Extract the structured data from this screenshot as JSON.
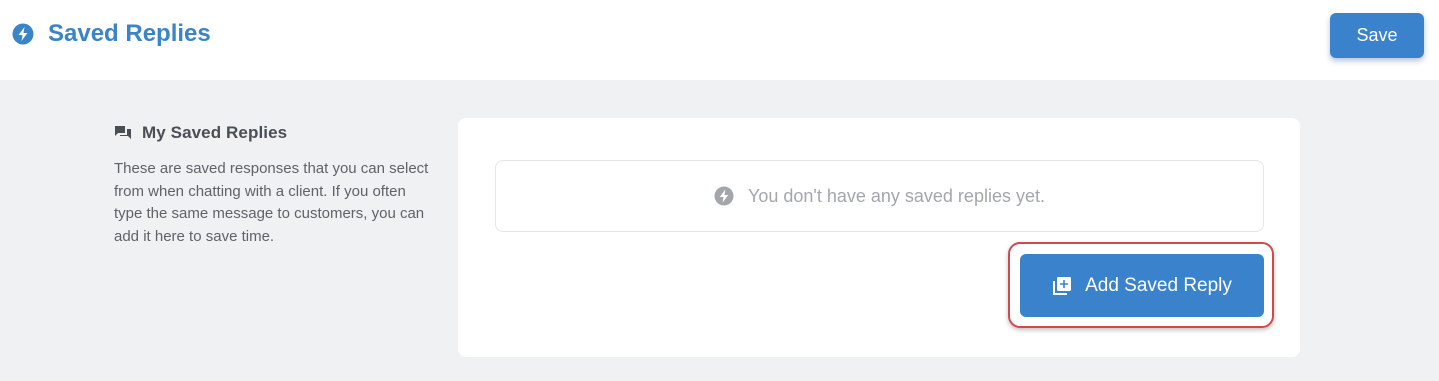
{
  "header": {
    "title": "Saved Replies",
    "title_icon": "lightning-bolt-icon",
    "save_label": "Save"
  },
  "sidebar": {
    "heading": "My Saved Replies",
    "heading_icon": "chat-bubbles-icon",
    "description": "These are saved responses that you can select from when chatting with a client. If you often type the same message to customers, you can add it here to save time."
  },
  "main": {
    "empty_icon": "lightning-bolt-icon",
    "empty_message": "You don't have any saved replies yet.",
    "add_button_label": "Add Saved Reply",
    "add_button_icon": "add-to-library-icon"
  },
  "colors": {
    "accent": "#3a83cc",
    "title": "#3a84c8",
    "page_background": "#eff1f3",
    "highlight_outline": "#cf4b4b"
  }
}
